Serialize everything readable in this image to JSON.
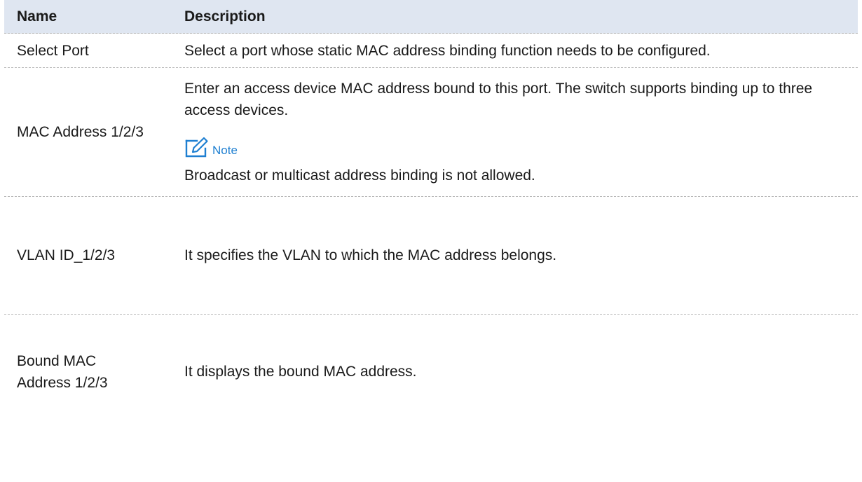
{
  "table": {
    "header": {
      "name": "Name",
      "description": "Description"
    },
    "rows": [
      {
        "name": "Select Port",
        "description": "Select a port whose static MAC address binding function needs to be configured."
      },
      {
        "name": "MAC Address 1/2/3",
        "description": "Enter an access device MAC address bound to this port. The switch supports binding up to three access devices.",
        "note_label": "Note",
        "note_text": "Broadcast or multicast address binding is not allowed."
      },
      {
        "name": "VLAN ID_1/2/3",
        "description": "It specifies the VLAN to which the MAC address belongs."
      },
      {
        "name": "Bound MAC Address 1/2/3",
        "description": "It displays the bound MAC address."
      }
    ]
  },
  "colors": {
    "header_bg": "#dfe6f1",
    "note_accent": "#1e7fd1",
    "divider": "#b7b7b7"
  },
  "icons": {
    "note": "note-pencil-icon"
  }
}
